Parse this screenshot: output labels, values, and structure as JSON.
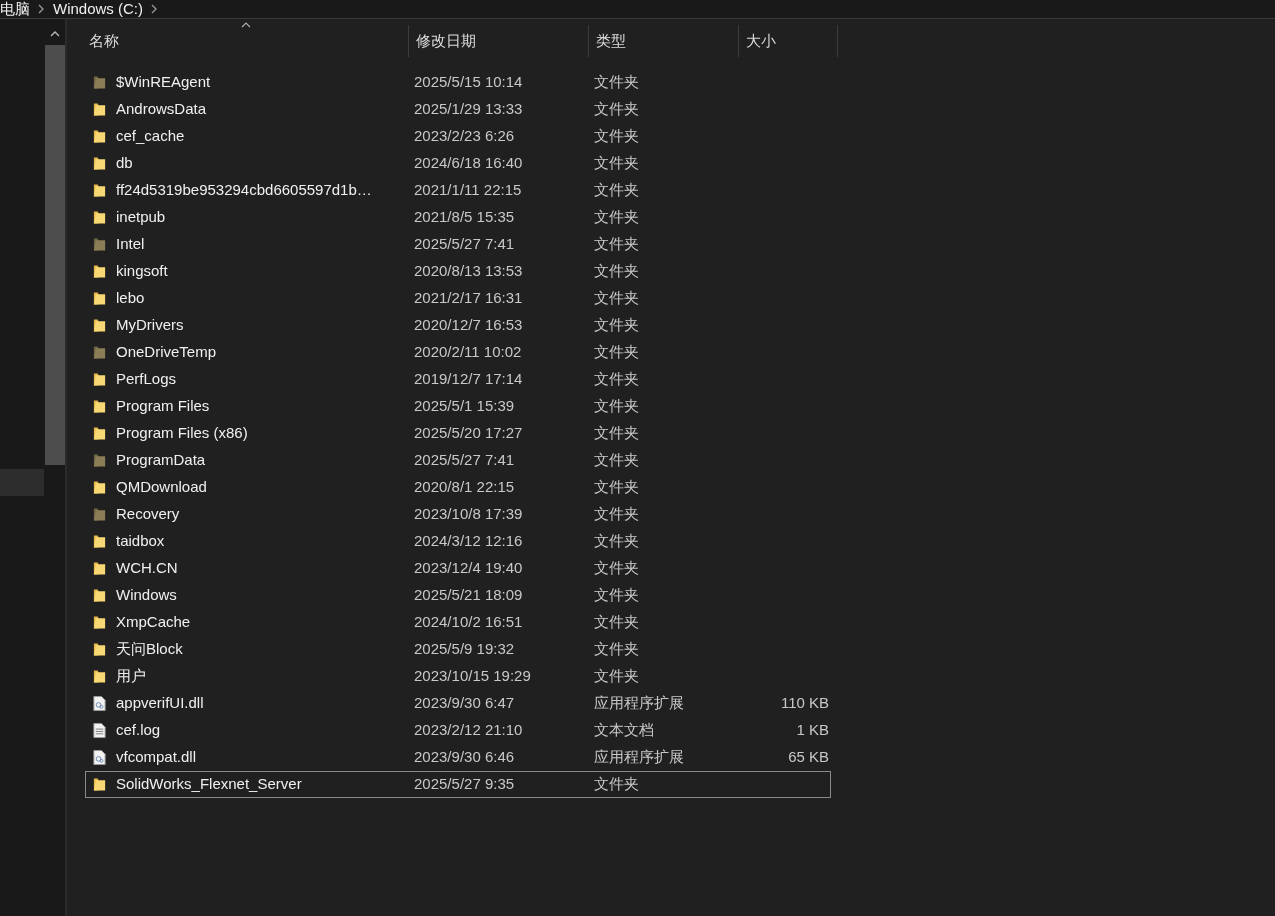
{
  "breadcrumb": [
    "电脑",
    "Windows (C:)"
  ],
  "table": {
    "columns": [
      "名称",
      "修改日期",
      "类型",
      "大小"
    ],
    "rows": [
      {
        "kind": "hidden-folder",
        "name": "$WinREAgent",
        "date": "2025/5/15 10:14",
        "type": "文件夹",
        "focused": false
      },
      {
        "kind": "folder",
        "name": "AndrowsData",
        "date": "2025/1/29 13:33",
        "type": "文件夹",
        "focused": false
      },
      {
        "kind": "folder",
        "name": "cef_cache",
        "date": "2023/2/23 6:26",
        "type": "文件夹",
        "focused": false
      },
      {
        "kind": "folder",
        "name": "db",
        "date": "2024/6/18 16:40",
        "type": "文件夹",
        "focused": false
      },
      {
        "kind": "folder",
        "name": "ff24d5319be953294cbd6605597d1b…",
        "date": "2021/1/11 22:15",
        "type": "文件夹",
        "focused": false
      },
      {
        "kind": "folder",
        "name": "inetpub",
        "date": "2021/8/5 15:35",
        "type": "文件夹",
        "focused": false
      },
      {
        "kind": "hidden-folder",
        "name": "Intel",
        "date": "2025/5/27 7:41",
        "type": "文件夹",
        "focused": false
      },
      {
        "kind": "folder",
        "name": "kingsoft",
        "date": "2020/8/13 13:53",
        "type": "文件夹",
        "focused": false
      },
      {
        "kind": "folder",
        "name": "lebo",
        "date": "2021/2/17 16:31",
        "type": "文件夹",
        "focused": false
      },
      {
        "kind": "folder",
        "name": "MyDrivers",
        "date": "2020/12/7 16:53",
        "type": "文件夹",
        "focused": false
      },
      {
        "kind": "hidden-folder",
        "name": "OneDriveTemp",
        "date": "2020/2/11 10:02",
        "type": "文件夹",
        "focused": false
      },
      {
        "kind": "folder",
        "name": "PerfLogs",
        "date": "2019/12/7 17:14",
        "type": "文件夹",
        "focused": false
      },
      {
        "kind": "folder",
        "name": "Program Files",
        "date": "2025/5/1 15:39",
        "type": "文件夹",
        "focused": false
      },
      {
        "kind": "folder",
        "name": "Program Files (x86)",
        "date": "2025/5/20 17:27",
        "type": "文件夹",
        "focused": false
      },
      {
        "kind": "hidden-folder",
        "name": "ProgramData",
        "date": "2025/5/27 7:41",
        "type": "文件夹",
        "focused": false
      },
      {
        "kind": "folder",
        "name": "QMDownload",
        "date": "2020/8/1 22:15",
        "type": "文件夹",
        "focused": false
      },
      {
        "kind": "hidden-folder",
        "name": "Recovery",
        "date": "2023/10/8 17:39",
        "type": "文件夹",
        "focused": false
      },
      {
        "kind": "folder",
        "name": "taidbox",
        "date": "2024/3/12 12:16",
        "type": "文件夹",
        "focused": false
      },
      {
        "kind": "folder",
        "name": "WCH.CN",
        "date": "2023/12/4 19:40",
        "type": "文件夹",
        "focused": false
      },
      {
        "kind": "folder",
        "name": "Windows",
        "date": "2025/5/21 18:09",
        "type": "文件夹",
        "focused": false
      },
      {
        "kind": "folder",
        "name": "XmpCache",
        "date": "2024/10/2 16:51",
        "type": "文件夹",
        "focused": false
      },
      {
        "kind": "folder",
        "name": "天问Block",
        "date": "2025/5/9 19:32",
        "type": "文件夹",
        "focused": false
      },
      {
        "kind": "folder",
        "name": "用户",
        "date": "2023/10/15 19:29",
        "type": "文件夹",
        "focused": false
      },
      {
        "kind": "dll",
        "name": "appverifUI.dll",
        "date": "2023/9/30 6:47",
        "type": "应用程序扩展",
        "size": "110 KB",
        "focused": false
      },
      {
        "kind": "text",
        "name": "cef.log",
        "date": "2023/2/12 21:10",
        "type": "文本文档",
        "size": "1 KB",
        "focused": false
      },
      {
        "kind": "dll",
        "name": "vfcompat.dll",
        "date": "2023/9/30 6:46",
        "type": "应用程序扩展",
        "size": "65 KB",
        "focused": false
      },
      {
        "kind": "folder",
        "name": "SolidWorks_Flexnet_Server",
        "date": "2025/5/27 9:35",
        "type": "文件夹",
        "focused": true
      }
    ]
  }
}
